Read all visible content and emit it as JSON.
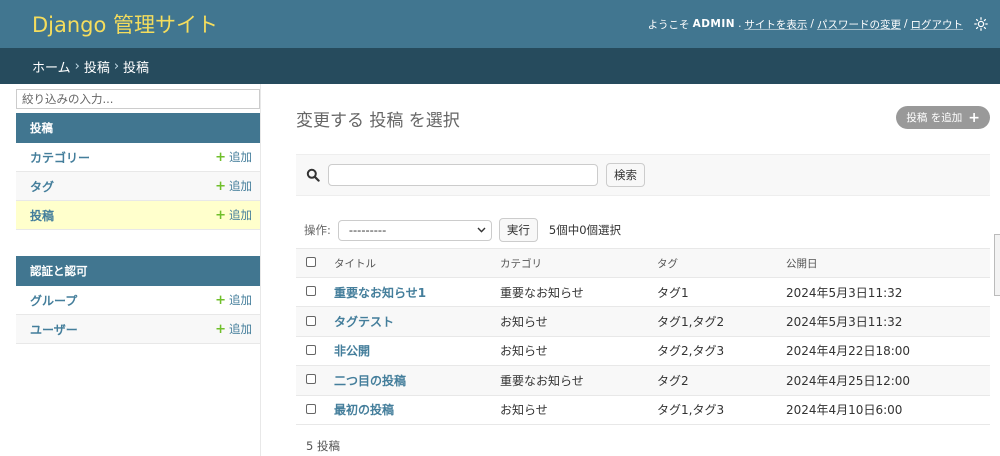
{
  "header": {
    "branding": "Django 管理サイト",
    "welcome": "ようこそ",
    "username": "ADMIN",
    "punct": ".",
    "view_site": "サイトを表示",
    "sep": "/",
    "change_password": "パスワードの変更",
    "logout": "ログアウト",
    "theme_icon": "sun-icon"
  },
  "breadcrumbs": {
    "home": "ホーム",
    "sep": "›",
    "app": "投稿",
    "current": "投稿"
  },
  "sidebar": {
    "filter_placeholder": "絞り込みの入力...",
    "modules": [
      {
        "caption": "投稿",
        "items": [
          {
            "label": "カテゴリー",
            "add": "追加"
          },
          {
            "label": "タグ",
            "add": "追加"
          },
          {
            "label": "投稿",
            "add": "追加"
          }
        ]
      },
      {
        "caption": "認証と認可",
        "items": [
          {
            "label": "グループ",
            "add": "追加"
          },
          {
            "label": "ユーザー",
            "add": "追加"
          }
        ]
      }
    ],
    "add_icon": "+"
  },
  "content": {
    "title": "変更する 投稿 を選択",
    "add_button": "投稿 を追加",
    "add_icon": "+",
    "search_button": "検索",
    "search_value": "",
    "actions_label": "操作:",
    "action_selected": "---------",
    "run_button": "実行",
    "counter": "5個中0個選択",
    "columns": [
      "タイトル",
      "カテゴリ",
      "タグ",
      "公開日"
    ],
    "rows": [
      {
        "title": "重要なお知らせ1",
        "category": "重要なお知らせ",
        "tags": "タグ1",
        "date": "2024年5月3日11:32"
      },
      {
        "title": "タグテスト",
        "category": "お知らせ",
        "tags": "タグ1,タグ2",
        "date": "2024年5月3日11:32"
      },
      {
        "title": "非公開",
        "category": "お知らせ",
        "tags": "タグ2,タグ3",
        "date": "2024年4月22日18:00"
      },
      {
        "title": "二つ目の投稿",
        "category": "重要なお知らせ",
        "tags": "タグ2",
        "date": "2024年4月25日12:00"
      },
      {
        "title": "最初の投稿",
        "category": "お知らせ",
        "tags": "タグ1,タグ3",
        "date": "2024年4月10日6:00"
      }
    ],
    "paginator": "5 投稿"
  },
  "colors": {
    "header_bg": "#417690",
    "breadcrumb_bg": "#264b5d",
    "branding": "#f5dd5d",
    "link": "#447e9b",
    "add_plus": "#70bf2b",
    "current_row": "#ffffcc"
  }
}
